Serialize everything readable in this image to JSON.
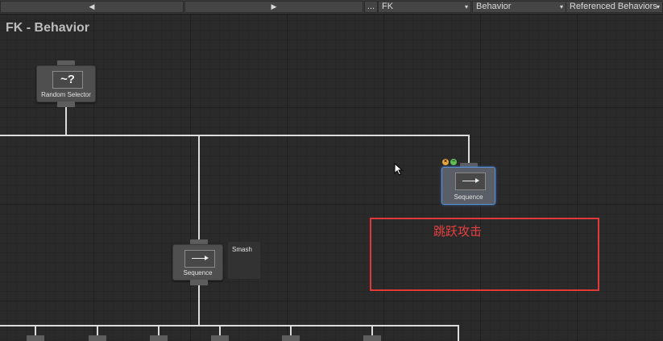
{
  "toolbar": {
    "nav_back_icon": "◀",
    "nav_forward_icon": "▶",
    "more_label": "...",
    "object_select": "FK",
    "behavior_select": "Behavior",
    "referenced_select": "Referenced Behaviors",
    "caret": "▾"
  },
  "graph": {
    "title": "FK - Behavior"
  },
  "nodes": {
    "random_selector": {
      "glyph": "~?",
      "label": "Random Selector"
    },
    "sequence_selected": {
      "label": "Sequence"
    },
    "sequence_smash": {
      "label": "Sequence",
      "comment": "Smash"
    }
  },
  "annotation": {
    "text": "跳跃攻击",
    "color": "#e23a3a"
  },
  "colors": {
    "canvas": "#2a2a2a",
    "line": "#dcdcdc",
    "selection": "#5b8fd6"
  }
}
